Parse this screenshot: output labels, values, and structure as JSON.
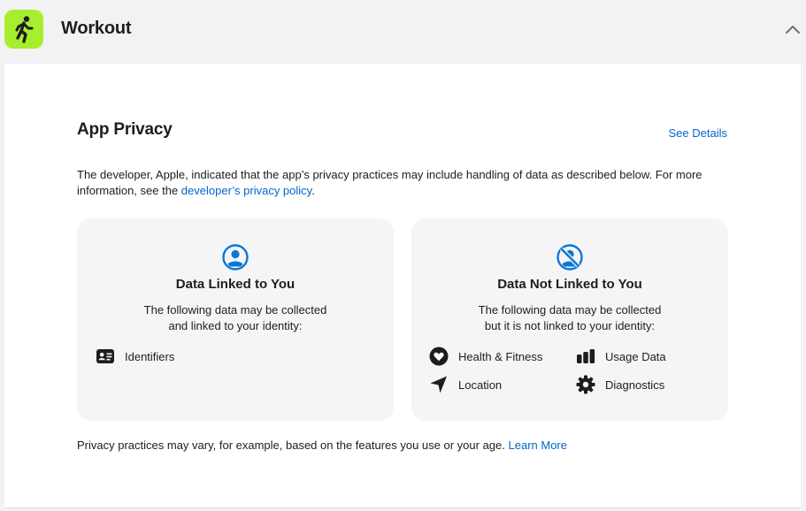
{
  "header": {
    "app_name": "Workout",
    "icon_name": "running-figure-icon",
    "icon_bg": "#a7ee2f",
    "collapse_icon": "chevron-up-icon"
  },
  "privacy": {
    "title": "App Privacy",
    "see_details": "See Details",
    "description_prefix": "The developer, Apple, indicated that the app’s privacy practices may include handling of data as described below. For more information, see the ",
    "policy_link": "developer’s privacy policy",
    "description_suffix": ".",
    "linked": {
      "title": "Data Linked to You",
      "subtitle_line1": "The following data may be collected",
      "subtitle_line2": "and linked to your identity:",
      "icon_name": "person-circle-icon",
      "items": [
        {
          "label": "Identifiers",
          "icon": "id-card-icon"
        }
      ]
    },
    "not_linked": {
      "title": "Data Not Linked to You",
      "subtitle_line1": "The following data may be collected",
      "subtitle_line2": "but it is not linked to your identity:",
      "icon_name": "person-circle-slash-icon",
      "items": [
        {
          "label": "Health & Fitness",
          "icon": "heart-circle-icon"
        },
        {
          "label": "Usage Data",
          "icon": "bar-chart-icon"
        },
        {
          "label": "Location",
          "icon": "location-arrow-icon"
        },
        {
          "label": "Diagnostics",
          "icon": "gear-icon"
        }
      ]
    },
    "footer_text": "Privacy practices may vary, for example, based on the features you use or your age. ",
    "learn_more": "Learn More"
  },
  "colors": {
    "accent": "#0066cc",
    "card_bg": "#f5f5f7"
  }
}
